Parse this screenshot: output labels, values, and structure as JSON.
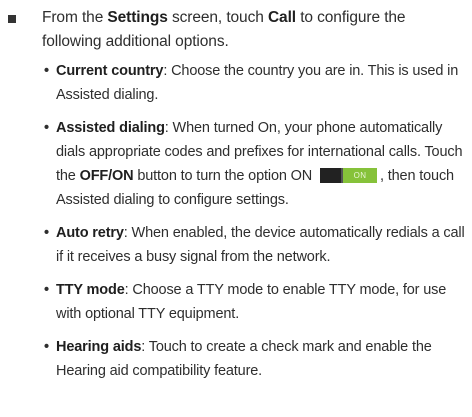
{
  "intro": {
    "prefix": "From the ",
    "settings": "Settings",
    "mid": " screen, touch ",
    "call": "Call",
    "suffix": " to configure the following additional options."
  },
  "items": [
    {
      "term": "Current country",
      "text": ": Choose the country you are in. This is used in Assisted dialing."
    },
    {
      "term": "Assisted dialing",
      "text_a": ": When turned On, your phone automatically dials appropriate codes and prefixes for international calls. Touch the ",
      "button": "OFF/ON",
      "text_b": " button to turn the option ON ",
      "text_c": ", then touch Assisted dialing to configure settings.",
      "toggle_label": "ON"
    },
    {
      "term": "Auto retry",
      "text": ": When enabled, the device automatically redials a call if it receives a busy signal from the network."
    },
    {
      "term": "TTY mode",
      "text": ": Choose a TTY mode to enable TTY mode, for use with optional TTY equipment."
    },
    {
      "term": "Hearing aids",
      "text": ": Touch to create a check mark and enable the Hearing aid compatibility feature."
    }
  ],
  "colors": {
    "toggle_on": "#86c23a",
    "toggle_off": "#222222",
    "text": "#2e2e2e"
  }
}
